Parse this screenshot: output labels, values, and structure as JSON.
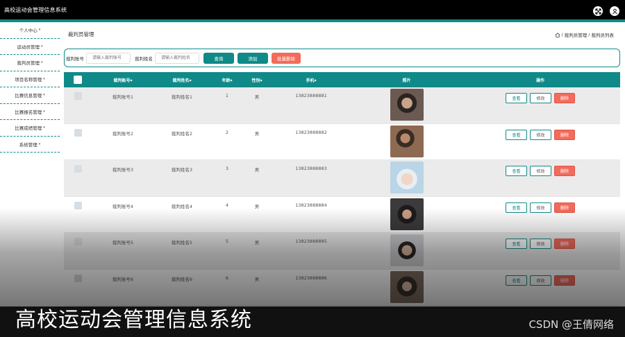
{
  "app": {
    "title": "高校运动会管理信息系统"
  },
  "sidebar": {
    "items": [
      {
        "label": "个人中心"
      },
      {
        "label": "运动员管理"
      },
      {
        "label": "裁判员管理"
      },
      {
        "label": "项目名称管理"
      },
      {
        "label": "比赛信息管理"
      },
      {
        "label": "比赛报名管理"
      },
      {
        "label": "比赛成绩管理"
      },
      {
        "label": "系统管理"
      }
    ]
  },
  "page": {
    "title": "裁判员管理",
    "breadcrumb_1": "裁判员管理",
    "breadcrumb_sep": "/",
    "breadcrumb_2": "裁判员列表"
  },
  "search": {
    "account_label": "裁判账号",
    "account_placeholder": "请输入裁判账号",
    "name_label": "裁判姓名",
    "name_placeholder": "请输入裁判姓名",
    "query_btn": "查询",
    "add_btn": "添加",
    "batch_delete_btn": "批量删除"
  },
  "table": {
    "headers": [
      "裁判账号",
      "裁判姓名",
      "年龄",
      "性别",
      "手机",
      "照片",
      "操作"
    ],
    "sort_glyph": "◆",
    "actions": {
      "view": "查看",
      "edit": "修改",
      "delete": "删除"
    },
    "rows": [
      {
        "account": "裁判账号1",
        "name": "裁判姓名1",
        "age": "1",
        "gender": "男",
        "phone": "13823888881"
      },
      {
        "account": "裁判账号2",
        "name": "裁判姓名2",
        "age": "2",
        "gender": "男",
        "phone": "13823888882"
      },
      {
        "account": "裁判账号3",
        "name": "裁判姓名3",
        "age": "3",
        "gender": "男",
        "phone": "13823888883"
      },
      {
        "account": "裁判账号4",
        "name": "裁判姓名4",
        "age": "4",
        "gender": "男",
        "phone": "13823888884"
      },
      {
        "account": "裁判账号5",
        "name": "裁判姓名5",
        "age": "5",
        "gender": "男",
        "phone": "13823888885"
      },
      {
        "account": "裁判账号6",
        "name": "裁判姓名6",
        "age": "6",
        "gender": "男",
        "phone": "13823888886"
      }
    ]
  },
  "overlay": {
    "caption": "高校运动会管理信息系统",
    "watermark": "CSDN @王倩网络"
  },
  "colors": {
    "accent": "#0f8a88",
    "danger": "#f26b5b",
    "topbar": "#000000"
  },
  "icons": {
    "fullscreen": "fullscreen-icon",
    "user": "user-icon",
    "home": "home-icon",
    "dropdown": "chevron-down-icon"
  }
}
